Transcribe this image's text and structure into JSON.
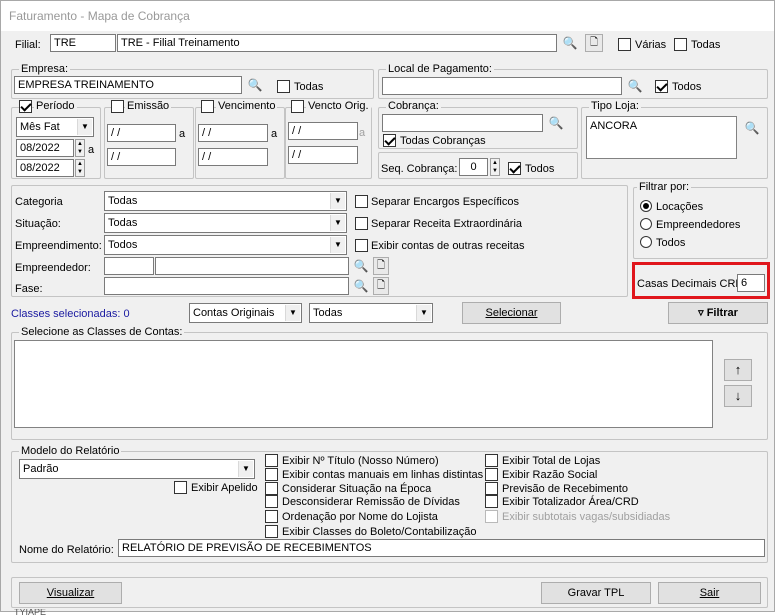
{
  "window": {
    "title": "Faturamento - Mapa de Cobrança"
  },
  "filial": {
    "label": "Filial:",
    "code": "TRE",
    "name": "TRE - Filial Treinamento",
    "varias_label": "Várias",
    "todas_label": "Todas"
  },
  "empresa": {
    "legend": "Empresa:",
    "value": "EMPRESA TREINAMENTO",
    "todas_label": "Todas"
  },
  "local_pagamento": {
    "legend": "Local de Pagamento:",
    "value": "",
    "todos_label": "Todos"
  },
  "periodo": {
    "legend": "Período",
    "tipo": "Mês Fat",
    "inicio": "08/2022",
    "fim": "08/2022",
    "a_label": "a"
  },
  "emissao": {
    "legend": "Emissão",
    "de": " / /",
    "ate": " / /",
    "a_label": "a"
  },
  "vencimento": {
    "legend": "Vencimento",
    "de": " / /",
    "ate": " / /",
    "a_label": "a"
  },
  "vencto_orig": {
    "legend": "Vencto Orig.",
    "de": " / /",
    "ate": " / /",
    "a_label": "a"
  },
  "cobranca": {
    "legend": "Cobrança:",
    "value": "",
    "todas_label": "Todas Cobranças",
    "seq_label": "Seq. Cobrança:",
    "seq_value": "0",
    "todos_label": "Todos"
  },
  "tipo_loja": {
    "legend": "Tipo Loja:",
    "value": "ANCORA"
  },
  "filtros": {
    "categoria_label": "Categoria",
    "categoria_value": "Todas",
    "situacao_label": "Situação:",
    "situacao_value": "Todas",
    "empreendimento_label": "Empreendimento:",
    "empreendimento_value": "Todos",
    "empreendedor_label": "Empreendedor:",
    "fase_label": "Fase:",
    "separar_encargos": "Separar Encargos Específicos",
    "separar_receita": "Separar Receita Extraordinária",
    "exibir_contas": "Exibir contas de outras receitas"
  },
  "filtrar_por": {
    "legend": "Filtrar por:",
    "options": [
      "Locações",
      "Empreendedores",
      "Todos"
    ]
  },
  "casas_decimais": {
    "label": "Casas Decimais CRD",
    "value": "6"
  },
  "classes": {
    "selecionadas_label": "Classes selecionadas: 0",
    "tipo": "Contas Originais",
    "filtro": "Todas",
    "selecionar_label": "Selecionar",
    "filtrar_label": "Filtrar",
    "legend": "Selecione as Classes de Contas:"
  },
  "modelo": {
    "legend": "Modelo do Relatório",
    "value": "Padrão",
    "exibir_apelido": "Exibir Apelido",
    "nome_label": "Nome do Relatório:",
    "nome_value": "RELATÓRIO DE PREVISÃO DE RECEBIMENTOS"
  },
  "opcoes_col1": [
    "Exibir Nº Título (Nosso Número)",
    "Exibir contas manuais em linhas distintas",
    "Considerar Situação na Época",
    "Desconsiderar Remissão de Dívidas",
    "Ordenação por Nome do Lojista",
    "Exibir Classes do Boleto/Contabilização"
  ],
  "opcoes_col2": [
    "Exibir Total de Lojas",
    "Exibir Razão Social",
    "Previsão de Recebimento",
    "Exibir Totalizador Área/CRD",
    "Exibir subtotais vagas/subsidiadas"
  ],
  "footer": {
    "visualizar": "Visualizar",
    "gravar": "Gravar TPL",
    "sair": "Sair"
  },
  "bottom_fragment": "ΤΥΙΑΡΕ",
  "colors": {
    "highlight": "#e0161c",
    "link_blue": "#1a1aa0"
  }
}
